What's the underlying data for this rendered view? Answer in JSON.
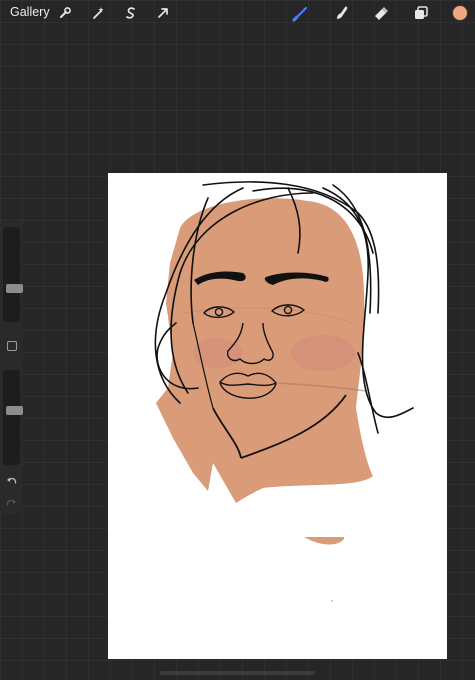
{
  "topbar": {
    "gallery_label": "Gallery",
    "left_tools": [
      "wrench-icon",
      "magic-wand-icon",
      "selection-s-icon",
      "transform-arrow-icon"
    ],
    "right_tools": [
      "brush-icon",
      "smudge-icon",
      "eraser-icon",
      "layers-icon"
    ],
    "active_tool": "brush-icon",
    "active_tool_color": "#4a7dff",
    "current_color": "#f0a77f"
  },
  "sidebar": {
    "size_slider_value": 0.3,
    "opacity_slider_value": 0.55,
    "icons": [
      "modify-square-icon",
      "undo-icon",
      "redo-icon"
    ]
  },
  "canvas": {
    "skin_color": "#d99b78",
    "line_color": "#111111"
  }
}
